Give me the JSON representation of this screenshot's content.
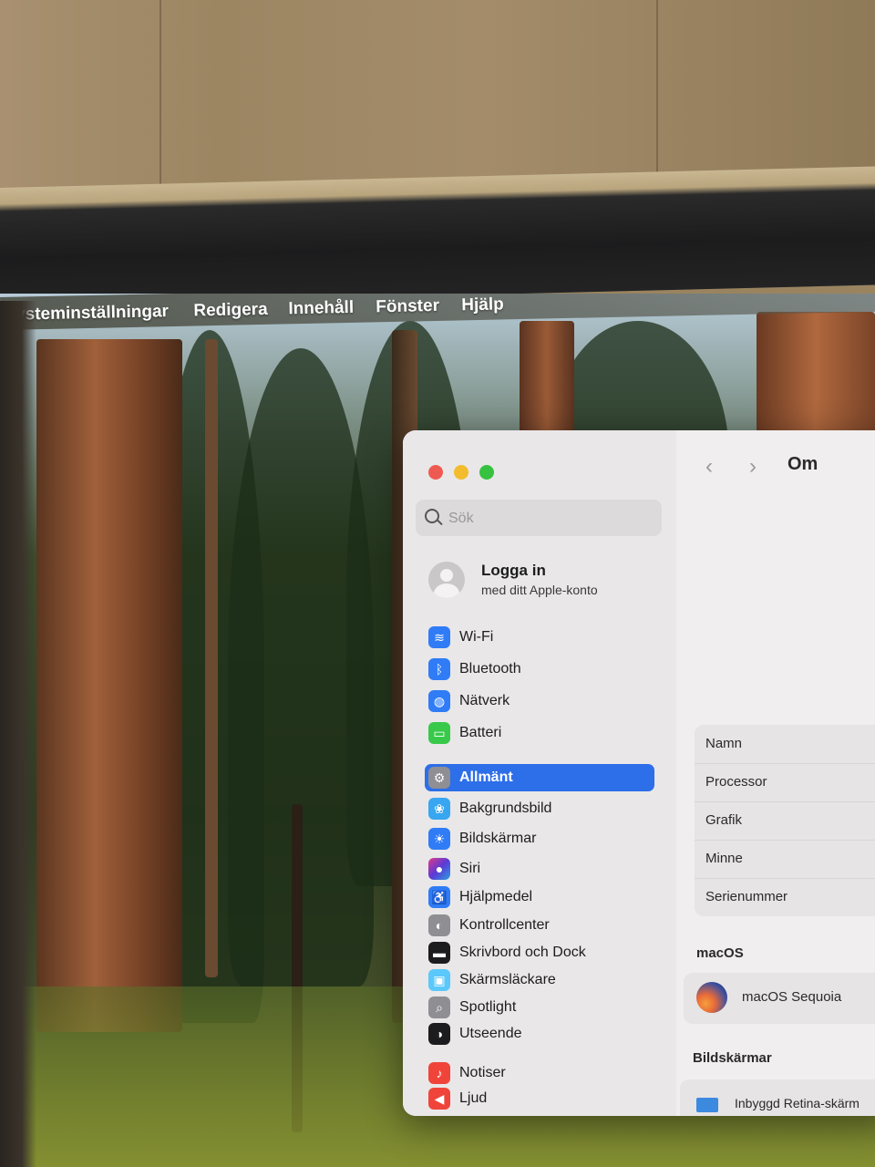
{
  "menubar": {
    "app_name": "Systeminställningar",
    "items": [
      "Redigera",
      "Innehåll",
      "Fönster",
      "Hjälp"
    ]
  },
  "window": {
    "search": {
      "placeholder": "Sök"
    },
    "account": {
      "title": "Logga in",
      "subtitle": "med ditt Apple-konto"
    },
    "sidebar_items": [
      {
        "label": "Wi-Fi",
        "icon": "wifi-icon",
        "color": "#2f7cf6"
      },
      {
        "label": "Bluetooth",
        "icon": "bluetooth-icon",
        "color": "#2f7cf6"
      },
      {
        "label": "Nätverk",
        "icon": "globe-icon",
        "color": "#2f7cf6"
      },
      {
        "label": "Batteri",
        "icon": "battery-icon",
        "color": "#38c94a"
      },
      {
        "label": "Allmänt",
        "icon": "gear-icon",
        "color": "#8e8e93",
        "selected": true
      },
      {
        "label": "Bakgrundsbild",
        "icon": "flower-icon",
        "color": "#38a6f0"
      },
      {
        "label": "Bildskärmar",
        "icon": "sun-icon",
        "color": "#2f7cf6"
      },
      {
        "label": "Siri",
        "icon": "siri-icon",
        "color": "#b23bd6"
      },
      {
        "label": "Hjälpmedel",
        "icon": "accessibility-icon",
        "color": "#2f7cf6"
      },
      {
        "label": "Kontrollcenter",
        "icon": "toggles-icon",
        "color": "#8e8e93"
      },
      {
        "label": "Skrivbord och Dock",
        "icon": "dock-icon",
        "color": "#1c1c1e"
      },
      {
        "label": "Skärmsläckare",
        "icon": "screensaver-icon",
        "color": "#5ac8fa"
      },
      {
        "label": "Spotlight",
        "icon": "magnifier-icon",
        "color": "#8e8e93"
      },
      {
        "label": "Utseende",
        "icon": "appearance-icon",
        "color": "#1c1c1e"
      },
      {
        "label": "Notiser",
        "icon": "bell-icon",
        "color": "#f0443a"
      },
      {
        "label": "Ljud",
        "icon": "speaker-icon",
        "color": "#f0443a"
      }
    ],
    "pane": {
      "title": "Om",
      "info_rows": [
        "Namn",
        "Processor",
        "Grafik",
        "Minne",
        "Serienummer"
      ],
      "macos_section": "macOS",
      "macos_name": "macOS Sequoia",
      "displays_section": "Bildskärmar",
      "display_name": "Inbyggd Retina-skärm"
    }
  }
}
